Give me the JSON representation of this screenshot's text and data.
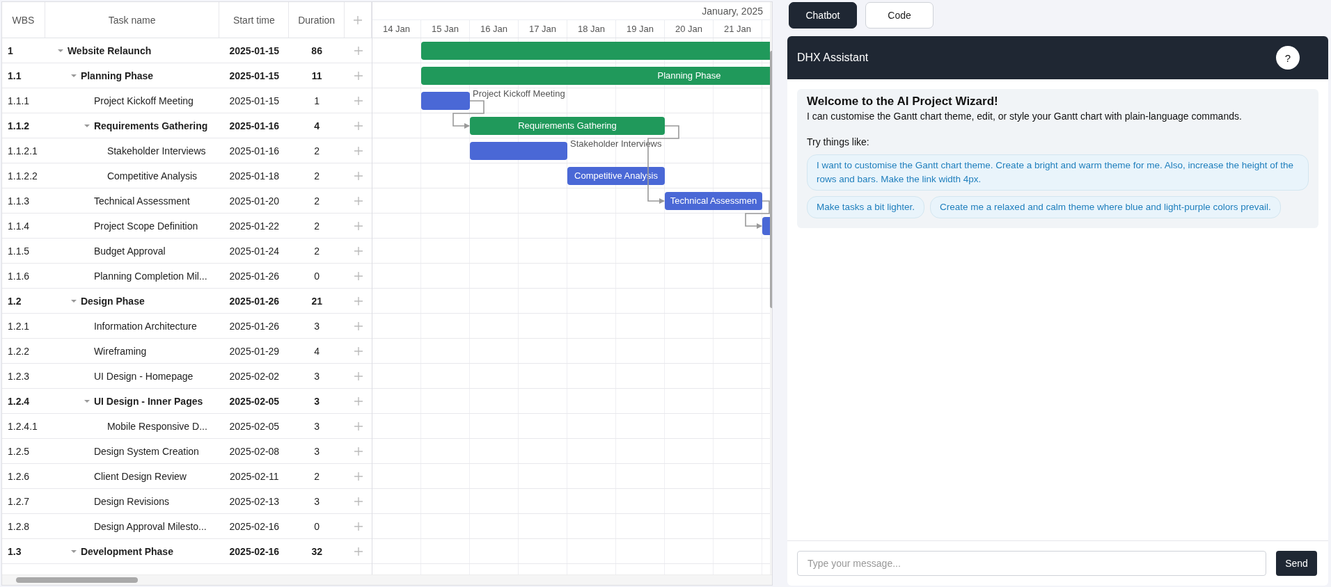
{
  "gantt": {
    "columns": [
      "WBS",
      "Task name",
      "Start time",
      "Duration"
    ],
    "scale": {
      "month": "January, 2025",
      "days": [
        "14 Jan",
        "15 Jan",
        "16 Jan",
        "17 Jan",
        "18 Jan",
        "19 Jan",
        "20 Jan",
        "21 Jan"
      ]
    },
    "tasks": [
      {
        "wbs": "1",
        "name": "Website Relaunch",
        "start": "2025-01-15",
        "duration": "86",
        "kind": "project",
        "expanded": true,
        "children": [
          {
            "wbs": "1.1",
            "name": "Planning Phase",
            "start": "2025-01-15",
            "duration": "11",
            "kind": "project",
            "expanded": true,
            "bar_label": "Planning Phase",
            "label_outside": false,
            "children": [
              {
                "wbs": "1.1.1",
                "name": "Project Kickoff Meeting",
                "start": "2025-01-15",
                "duration": "1",
                "kind": "task",
                "bar_label": "Project Kickoff Meeting",
                "label_outside": true
              },
              {
                "wbs": "1.1.2",
                "name": "Requirements Gathering",
                "start": "2025-01-16",
                "duration": "4",
                "kind": "project",
                "expanded": true,
                "bar_label": "Requirements Gathering",
                "label_outside": false,
                "children": [
                  {
                    "wbs": "1.1.2.1",
                    "name": "Stakeholder Interviews",
                    "start": "2025-01-16",
                    "duration": "2",
                    "kind": "task",
                    "bar_label": "Stakeholder Interviews",
                    "label_outside": true
                  },
                  {
                    "wbs": "1.1.2.2",
                    "name": "Competitive Analysis",
                    "start": "2025-01-18",
                    "duration": "2",
                    "kind": "task",
                    "bar_label": "Competitive Analysis",
                    "label_outside": false
                  }
                ]
              },
              {
                "wbs": "1.1.3",
                "name": "Technical Assessment",
                "start": "2025-01-20",
                "duration": "2",
                "kind": "task",
                "bar_label": "Technical Assessmen",
                "label_outside": false
              },
              {
                "wbs": "1.1.4",
                "name": "Project Scope Definition",
                "start": "2025-01-22",
                "duration": "2",
                "kind": "task"
              },
              {
                "wbs": "1.1.5",
                "name": "Budget Approval",
                "start": "2025-01-24",
                "duration": "2",
                "kind": "task"
              },
              {
                "wbs": "1.1.6",
                "name": "Planning Completion Mil...",
                "start": "2025-01-26",
                "duration": "0",
                "kind": "task"
              }
            ]
          },
          {
            "wbs": "1.2",
            "name": "Design Phase",
            "start": "2025-01-26",
            "duration": "21",
            "kind": "project",
            "expanded": true,
            "children": [
              {
                "wbs": "1.2.1",
                "name": "Information Architecture",
                "start": "2025-01-26",
                "duration": "3",
                "kind": "task"
              },
              {
                "wbs": "1.2.2",
                "name": "Wireframing",
                "start": "2025-01-29",
                "duration": "4",
                "kind": "task"
              },
              {
                "wbs": "1.2.3",
                "name": "UI Design - Homepage",
                "start": "2025-02-02",
                "duration": "3",
                "kind": "task"
              },
              {
                "wbs": "1.2.4",
                "name": "UI Design - Inner Pages",
                "start": "2025-02-05",
                "duration": "3",
                "kind": "project",
                "expanded": true,
                "children": [
                  {
                    "wbs": "1.2.4.1",
                    "name": "Mobile Responsive D...",
                    "start": "2025-02-05",
                    "duration": "3",
                    "kind": "task"
                  }
                ]
              },
              {
                "wbs": "1.2.5",
                "name": "Design System Creation",
                "start": "2025-02-08",
                "duration": "3",
                "kind": "task"
              },
              {
                "wbs": "1.2.6",
                "name": "Client Design Review",
                "start": "2025-02-11",
                "duration": "2",
                "kind": "task"
              },
              {
                "wbs": "1.2.7",
                "name": "Design Revisions",
                "start": "2025-02-13",
                "duration": "3",
                "kind": "task"
              },
              {
                "wbs": "1.2.8",
                "name": "Design Approval Milesto...",
                "start": "2025-02-16",
                "duration": "0",
                "kind": "task"
              }
            ]
          },
          {
            "wbs": "1.3",
            "name": "Development Phase",
            "start": "2025-02-16",
            "duration": "32",
            "kind": "project",
            "expanded": true
          }
        ]
      }
    ]
  },
  "chat": {
    "tabs": [
      {
        "label": "Chatbot",
        "selected": true
      },
      {
        "label": "Code",
        "selected": false
      }
    ],
    "title": "DHX Assistant",
    "help": "?",
    "welcome": {
      "title": "Welcome to the AI Project Wizard!",
      "text": "I can customise the Gantt chart theme, edit, or style your Gantt chart with plain-language commands.",
      "try_label": "Try things like:",
      "suggestions": [
        "I want to customise the Gantt chart theme. Create a bright and warm theme for me. Also, increase the height of the rows and bars. Make the link width 4px.",
        "Make tasks a bit lighter.",
        "Create me a relaxed and calm theme where blue and light-purple colors prevail."
      ]
    },
    "input": {
      "placeholder": "Type your message..."
    },
    "send": "Send"
  }
}
